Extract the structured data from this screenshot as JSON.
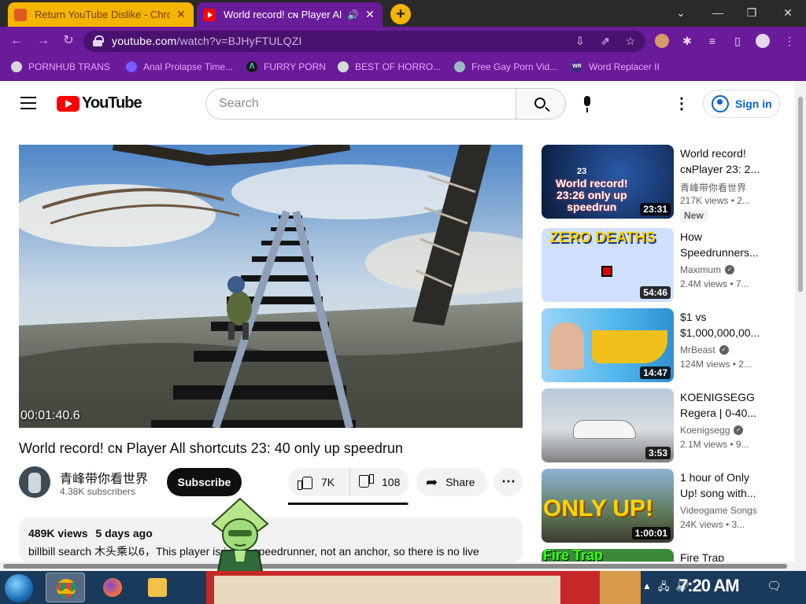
{
  "browser": {
    "tabs": [
      {
        "title": "Return YouTube Dislike - Chro"
      },
      {
        "title": "World record! ᴄɴ Player Al"
      }
    ],
    "new_tab_label": "+",
    "url_domain": "youtube.com",
    "url_path": "/watch?v=BJHyFTULQZI",
    "bookmarks": [
      {
        "label": "PORNHUB TRANS",
        "icon": "globe-icon"
      },
      {
        "label": "Anal Prolapse Time...",
        "icon": "bookmark-icon"
      },
      {
        "label": "FURRY PORN",
        "icon": "lambda-icon"
      },
      {
        "label": "BEST OF HORRO...",
        "icon": "globe-icon"
      },
      {
        "label": "Free Gay Porn Vid...",
        "icon": "bookmark-icon"
      },
      {
        "label": "Word Replacer II",
        "icon": "wr-icon"
      }
    ]
  },
  "youtube": {
    "logo_text": "YouTube",
    "search_placeholder": "Search",
    "signin_label": "Sign in"
  },
  "video": {
    "timestamp": "00:01:40.6",
    "title": "World record! ᴄɴ Player All shortcuts 23: 40 only up speedrun",
    "channel": "青峰带你看世界",
    "subscribers": "4.38K subscribers",
    "subscribe_label": "Subscribe",
    "likes": "7K",
    "dislikes": "108",
    "like_ratio": 0.985,
    "share_label": "Share",
    "views": "489K views",
    "age": "5 days ago",
    "description": "billbill search 木头乘以6，This player is just a speedrunner, not an anchor, so there is no live"
  },
  "recommendations": [
    {
      "title1": "World record!",
      "title2": "ᴄɴPlayer 23: 2...",
      "channel": "青峰带你看世界",
      "views": "217K views • 2...",
      "duration": "23:31",
      "badge": "New",
      "verified": false,
      "thumb_text": "World record!\n23:26 only up\nspeedrun",
      "thumb_small": "23"
    },
    {
      "title1": "How",
      "title2": "Speedrunners...",
      "channel": "Maximum",
      "views": "2.4M views • 7...",
      "duration": "54:46",
      "verified": true,
      "thumb_text": "ZERO DEATHS"
    },
    {
      "title1": "$1 vs",
      "title2": "$1,000,000,00...",
      "channel": "MrBeast",
      "views": "124M views • 2...",
      "duration": "14:47",
      "verified": true
    },
    {
      "title1": "KOENIGSEGG",
      "title2": "Regera | 0-40...",
      "channel": "Koenigsegg",
      "views": "2.1M views • 9...",
      "duration": "3:53",
      "verified": true
    },
    {
      "title1": "1 hour of Only",
      "title2": "Up! song with...",
      "channel": "Videogame Songs",
      "views": "24K views • 3...",
      "duration": "1:00:01",
      "verified": false,
      "thumb_text": "ONLY UP!"
    },
    {
      "title1": "Fire Trap",
      "thumb_text": "Fire Trap"
    }
  ],
  "taskbar": {
    "clock": "7:20 AM"
  }
}
